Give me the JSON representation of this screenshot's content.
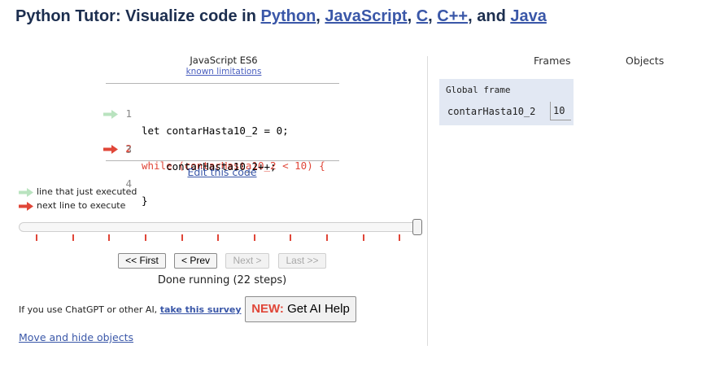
{
  "header": {
    "prefix": "Python Tutor: Visualize code in ",
    "languages": [
      "Python",
      "JavaScript",
      "C",
      "C++",
      "Java"
    ],
    "sep1": ", ",
    "sep2": ", ",
    "sep3": ", ",
    "sep4": ", and "
  },
  "editor": {
    "language_label": "JavaScript ES6",
    "known_limitations": "known limitations",
    "lines": [
      {
        "no": "1",
        "code": "let contarHasta10_2 = 0;"
      },
      {
        "no": "2",
        "code": "while (contarHasta10_2 < 10) {"
      },
      {
        "no": "3",
        "code": "    contarHasta10_2++;"
      },
      {
        "no": "4",
        "code": "}"
      }
    ],
    "edit_link": "Edit this code"
  },
  "legend": {
    "just_executed": "line that just executed",
    "next_line": "next line to execute",
    "just_executed_color": "#b9e3bf",
    "next_line_color": "#e04638"
  },
  "controls": {
    "first": "<< First",
    "prev": "< Prev",
    "next": "Next >",
    "last": "Last >>",
    "status": "Done running (22 steps)",
    "slider_position": 1.0
  },
  "ai": {
    "note_prefix": "If you use ChatGPT or other AI, ",
    "survey_link": "take this survey",
    "button_new": "NEW:",
    "button_label": " Get AI Help"
  },
  "move_link": "Move and hide objects",
  "viz": {
    "frames_header": "Frames",
    "objects_header": "Objects",
    "frame_title": "Global frame",
    "variable_name": "contarHasta10_2",
    "variable_value": "10"
  }
}
